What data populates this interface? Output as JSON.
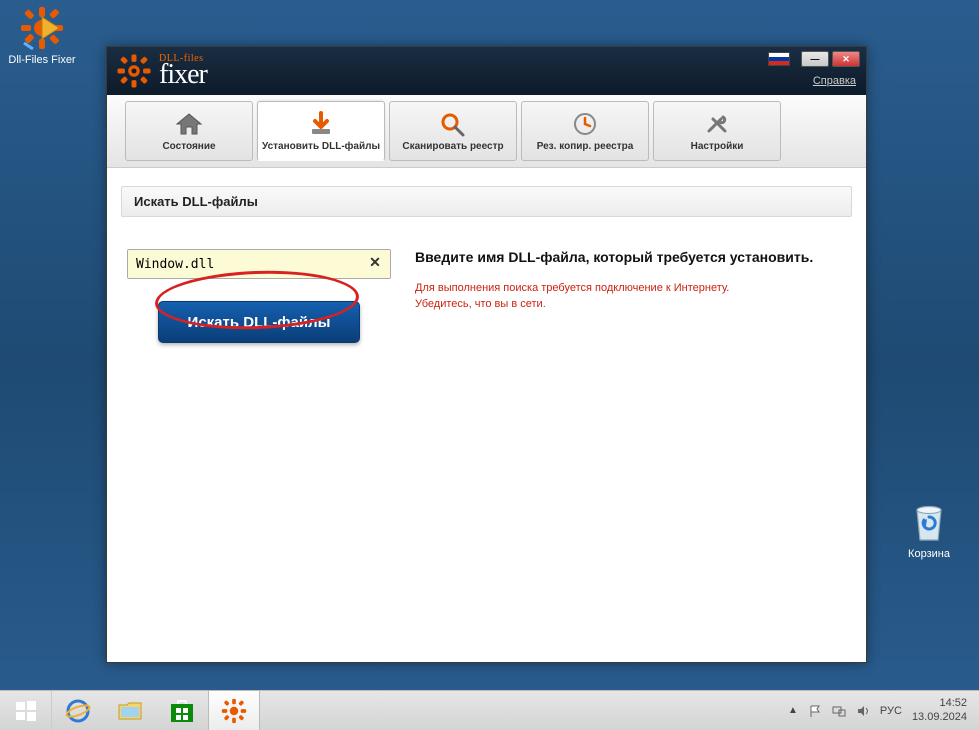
{
  "desktop": {
    "dll_fixer_label": "Dll-Files Fixer",
    "recycle_label": "Корзина"
  },
  "app": {
    "logo": {
      "small": "DLL-files",
      "big": "fixer"
    },
    "help_link": "Справка",
    "tabs": [
      {
        "label": "Состояние"
      },
      {
        "label": "Установить DLL-файлы"
      },
      {
        "label": "Сканировать реестр"
      },
      {
        "label": "Рез. копир. реестра"
      },
      {
        "label": "Настройки"
      }
    ],
    "section_title": "Искать DLL-файлы",
    "search_value": "Window.dll",
    "search_button": "Искать DLL-файлы",
    "right_title": "Введите имя DLL-файла, который требуется установить.",
    "error_line1": "Для выполнения поиска требуется подключение к Интернету.",
    "error_line2": "Убедитесь, что вы в сети."
  },
  "taskbar": {
    "lang": "РУС",
    "time": "14:52",
    "date": "13.09.2024"
  }
}
